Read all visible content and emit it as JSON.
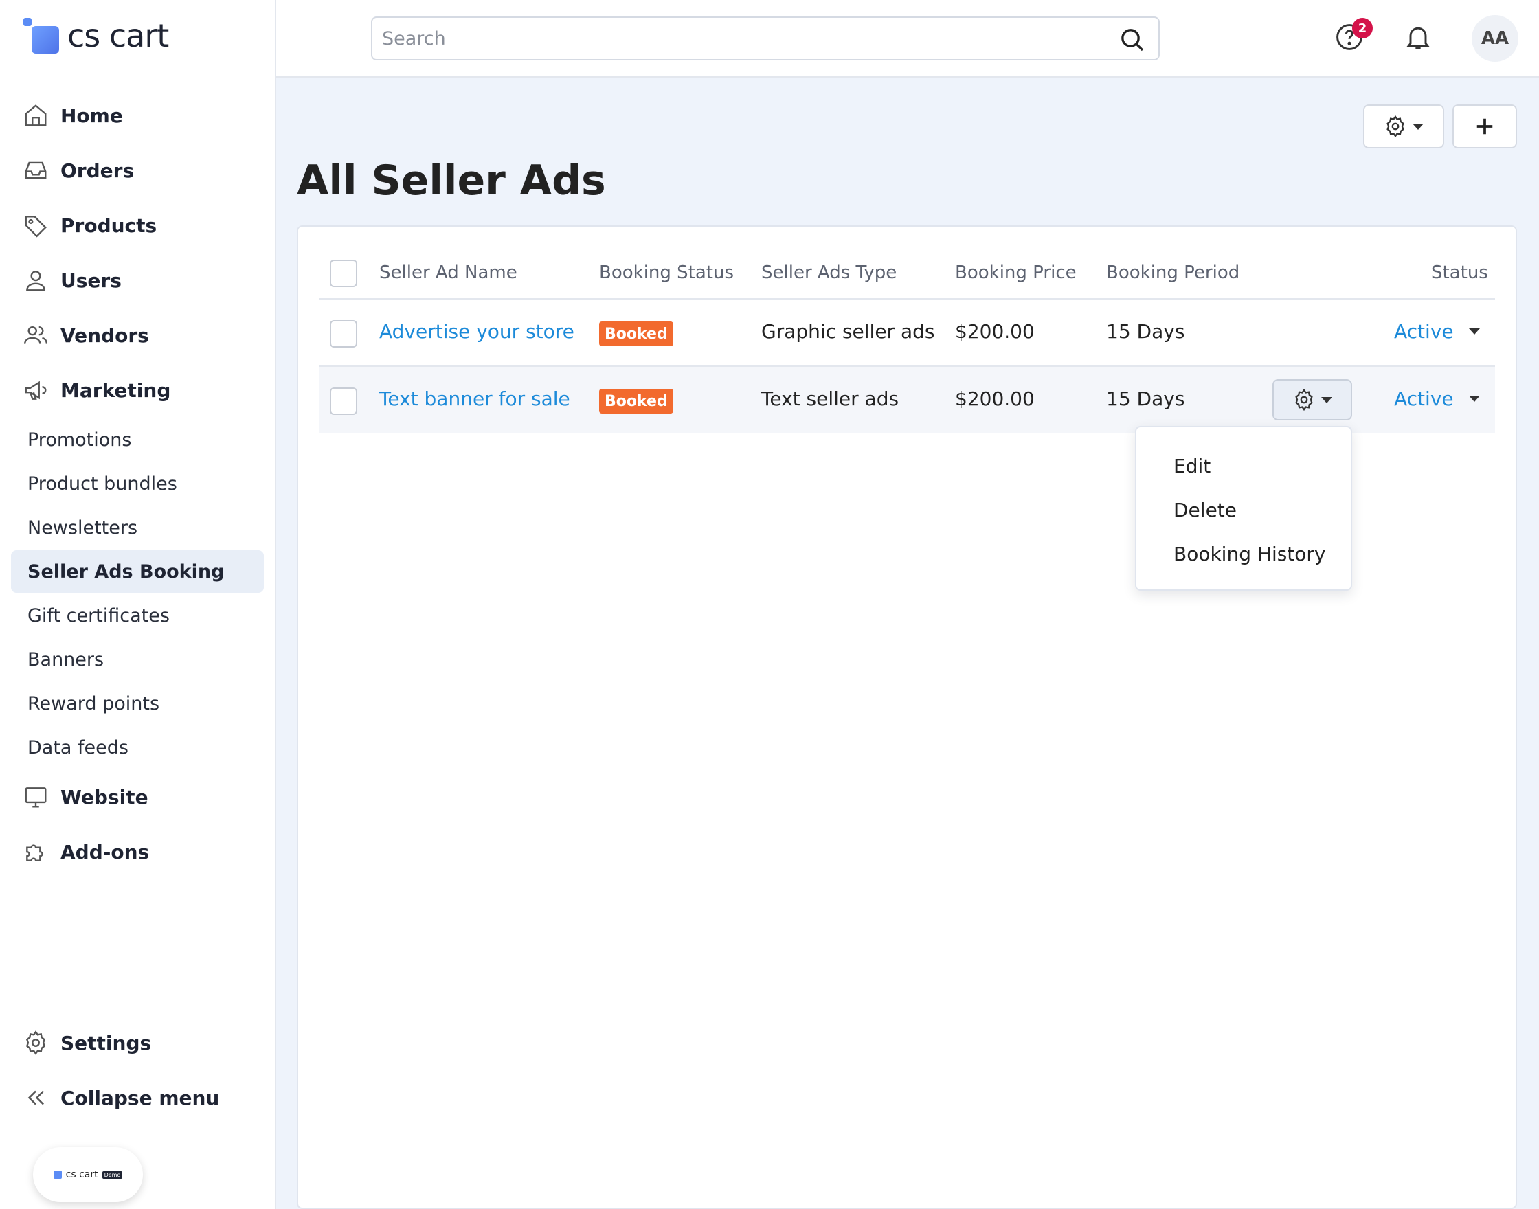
{
  "app": {
    "logo_text": "cs cart",
    "demo_logo_text": "cs cart",
    "demo_tag": "Demo"
  },
  "sidebar": {
    "items": [
      {
        "label": "Home",
        "icon": "home-icon"
      },
      {
        "label": "Orders",
        "icon": "inbox-icon"
      },
      {
        "label": "Products",
        "icon": "tag-icon"
      },
      {
        "label": "Users",
        "icon": "user-icon"
      },
      {
        "label": "Vendors",
        "icon": "users-icon"
      },
      {
        "label": "Marketing",
        "icon": "megaphone-icon"
      }
    ],
    "marketing_sub": [
      {
        "label": "Promotions"
      },
      {
        "label": "Product bundles"
      },
      {
        "label": "Newsletters"
      },
      {
        "label": "Seller Ads Booking",
        "active": true
      },
      {
        "label": "Gift certificates"
      },
      {
        "label": "Banners"
      },
      {
        "label": "Reward points"
      },
      {
        "label": "Data feeds"
      }
    ],
    "after_items": [
      {
        "label": "Website",
        "icon": "monitor-icon"
      },
      {
        "label": "Add-ons",
        "icon": "puzzle-icon"
      }
    ],
    "bottom": [
      {
        "label": "Settings",
        "icon": "gear-icon"
      },
      {
        "label": "Collapse menu",
        "icon": "chevrons-left-icon"
      }
    ]
  },
  "header": {
    "search_placeholder": "Search",
    "help_count": "2",
    "avatar_initials": "AA"
  },
  "page": {
    "title": "All Seller Ads"
  },
  "table": {
    "columns": [
      "Seller Ad Name",
      "Booking Status",
      "Seller Ads Type",
      "Booking Price",
      "Booking Period",
      "Status"
    ],
    "rows": [
      {
        "name": "Advertise your store",
        "booking_status": "Booked",
        "type": "Graphic seller ads",
        "price": "$200.00",
        "period": "15 Days",
        "status": "Active"
      },
      {
        "name": "Text banner for sale",
        "booking_status": "Booked",
        "type": "Text seller ads",
        "price": "$200.00",
        "period": "15 Days",
        "status": "Active"
      }
    ]
  },
  "row_menu": {
    "items": [
      "Edit",
      "Delete",
      "Booking History"
    ]
  },
  "colors": {
    "accent": "#1c8ad9",
    "badge": "#f26a2e",
    "notify": "#d4134a"
  }
}
